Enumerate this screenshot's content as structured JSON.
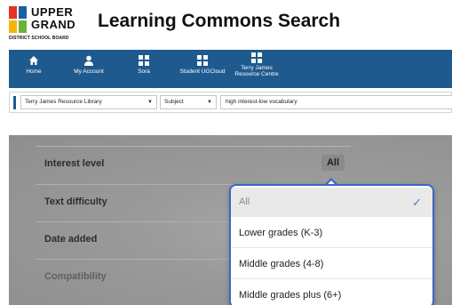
{
  "header": {
    "logo_line1": "UPPER",
    "logo_line2": "GRAND",
    "logo_sub": "DISTRICT SCHOOL BOARD",
    "title": "Learning Commons Search"
  },
  "nav": {
    "items": [
      {
        "label": "Home",
        "icon": "home-icon"
      },
      {
        "label": "My Account",
        "icon": "user-icon"
      },
      {
        "label": "Sora",
        "icon": "grid-icon"
      },
      {
        "label": "Student UGCloud",
        "icon": "grid-icon"
      },
      {
        "label1": "Terry James",
        "label2": "Resource Centre",
        "icon": "grid-icon"
      }
    ]
  },
  "search": {
    "library": "Terry James Resource Library",
    "field": "Subject",
    "query": "high interest-low vocabulary"
  },
  "filters": {
    "rows": [
      "Interest level",
      "Text difficulty",
      "Date added",
      "Compatibility"
    ],
    "interest_value": "All"
  },
  "dropdown": {
    "options": [
      "All",
      "Lower grades (K-3)",
      "Middle grades (4-8)",
      "Middle grades plus (6+)"
    ],
    "selected": "All",
    "check": "✓"
  },
  "colors": {
    "nav_bg": "#1f5a8f",
    "dropdown_border": "#3a67c9",
    "check": "#3a7bd5"
  }
}
